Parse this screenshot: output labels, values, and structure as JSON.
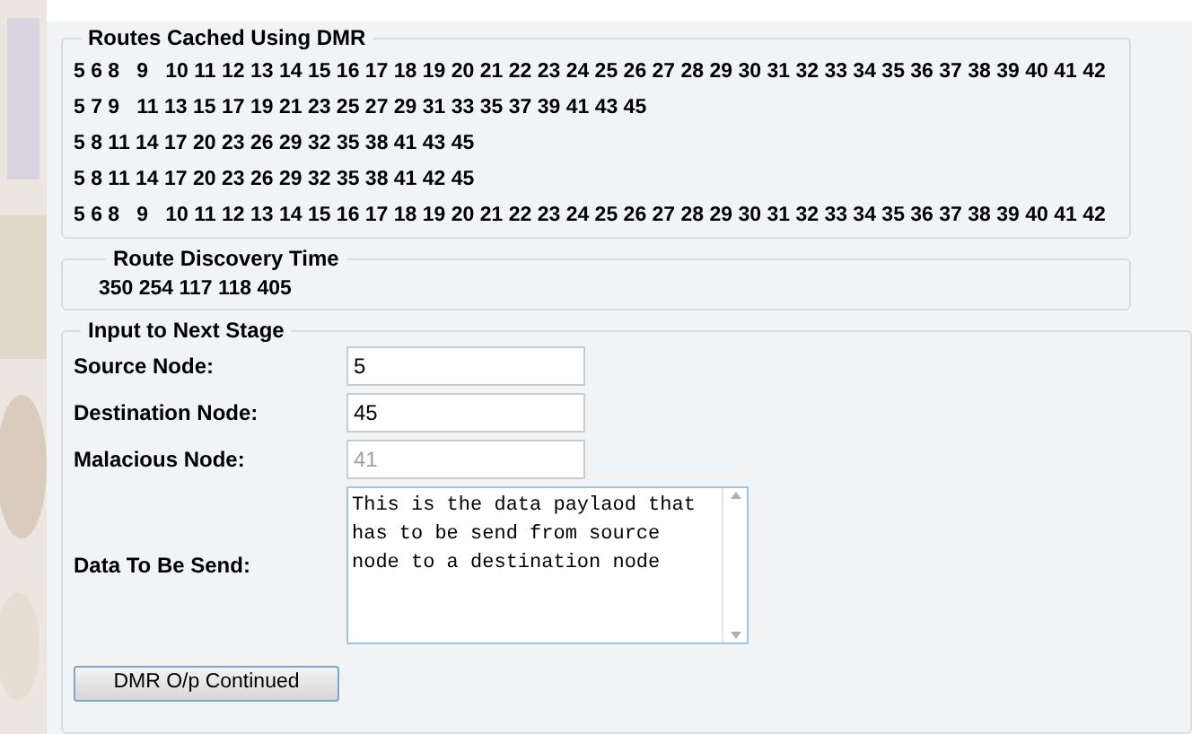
{
  "routes_cached": {
    "title": "Routes Cached Using DMR",
    "rows": [
      "5 6 8   9   10 11 12 13 14 15 16 17 18 19 20 21 22 23 24 25 26 27 28 29 30 31 32 33 34 35 36 37 38 39 40 41 42",
      "5 7 9   11 13 15 17 19 21 23 25 27 29 31 33 35 37 39 41 43 45",
      "5 8 11 14 17 20 23 26 29 32 35 38 41 43 45",
      "5 8 11 14 17 20 23 26 29 32 35 38 41 42 45",
      "5 6 8   9   10 11 12 13 14 15 16 17 18 19 20 21 22 23 24 25 26 27 28 29 30 31 32 33 34 35 36 37 38 39 40 41 42"
    ]
  },
  "route_discovery": {
    "title": "Route Discovery Time",
    "value": "350 254 117 118 405"
  },
  "input_stage": {
    "title": "Input to Next Stage",
    "fields": [
      {
        "label": "Source Node:",
        "value": "5",
        "disabled": false
      },
      {
        "label": "Destination Node:",
        "value": "45",
        "disabled": false
      },
      {
        "label": "Malacious Node:",
        "value": "41",
        "disabled": true
      }
    ],
    "data": {
      "label": "Data To Be Send:",
      "value": "This is the data paylaod that has to be send from source node to a destination node"
    },
    "button": "DMR O/p Continued"
  }
}
